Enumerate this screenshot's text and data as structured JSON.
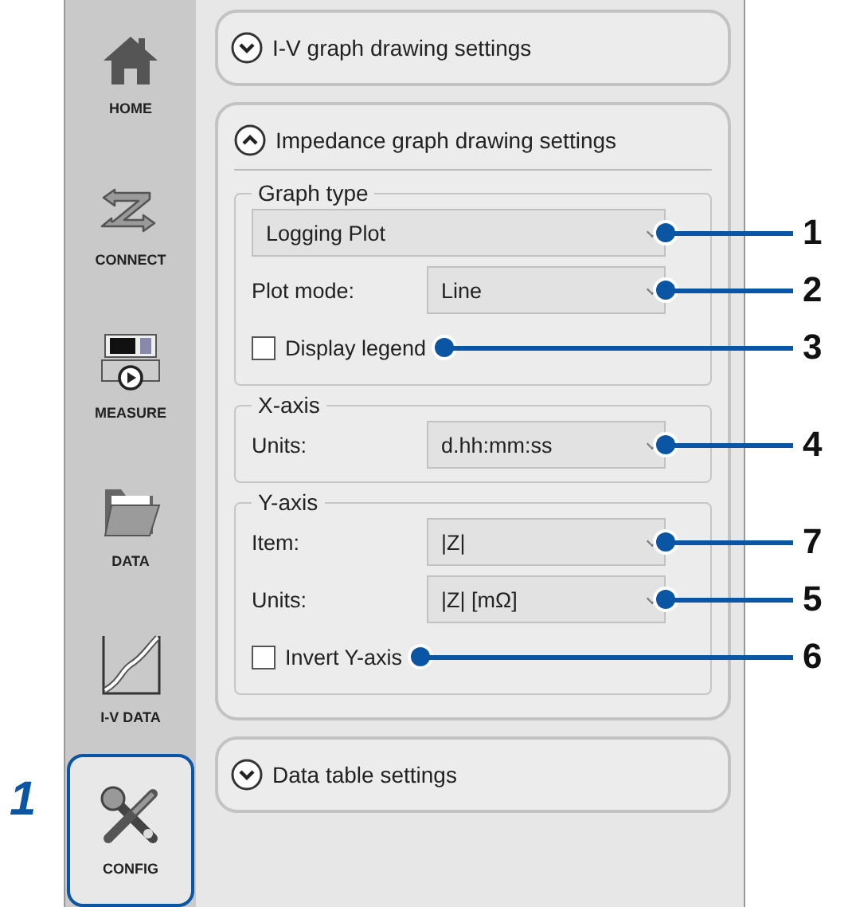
{
  "sidebar": {
    "items": [
      {
        "label": "HOME",
        "selected": false
      },
      {
        "label": "CONNECT",
        "selected": false
      },
      {
        "label": "MEASURE",
        "selected": false
      },
      {
        "label": "DATA",
        "selected": false
      },
      {
        "label": "I-V DATA",
        "selected": false
      },
      {
        "label": "CONFIG",
        "selected": true,
        "callout": "1"
      }
    ]
  },
  "sections": [
    {
      "title": "I-V graph drawing settings",
      "expanded": false
    },
    {
      "title": "Impedance graph drawing settings",
      "expanded": true,
      "groups": [
        {
          "title": "Graph type",
          "rows": [
            {
              "kind": "dropdown",
              "value": "Logging Plot",
              "callout": "1"
            },
            {
              "kind": "dropdown",
              "label": "Plot mode:",
              "value": "Line",
              "callout": "2"
            },
            {
              "kind": "checkbox",
              "label": "Display legend",
              "checked": false,
              "callout": "3"
            }
          ]
        },
        {
          "title": "X-axis",
          "rows": [
            {
              "kind": "dropdown",
              "label": "Units:",
              "value": "d.hh:mm:ss",
              "callout": "4"
            }
          ]
        },
        {
          "title": "Y-axis",
          "rows": [
            {
              "kind": "dropdown",
              "label": "Item:",
              "value": "|Z|",
              "callout": "7"
            },
            {
              "kind": "dropdown",
              "label": "Units:",
              "value": "|Z| [mΩ]",
              "callout": "5"
            },
            {
              "kind": "checkbox",
              "label": "Invert Y-axis",
              "checked": false,
              "callout": "6"
            }
          ]
        }
      ]
    },
    {
      "title": "Data table settings",
      "expanded": false
    }
  ]
}
